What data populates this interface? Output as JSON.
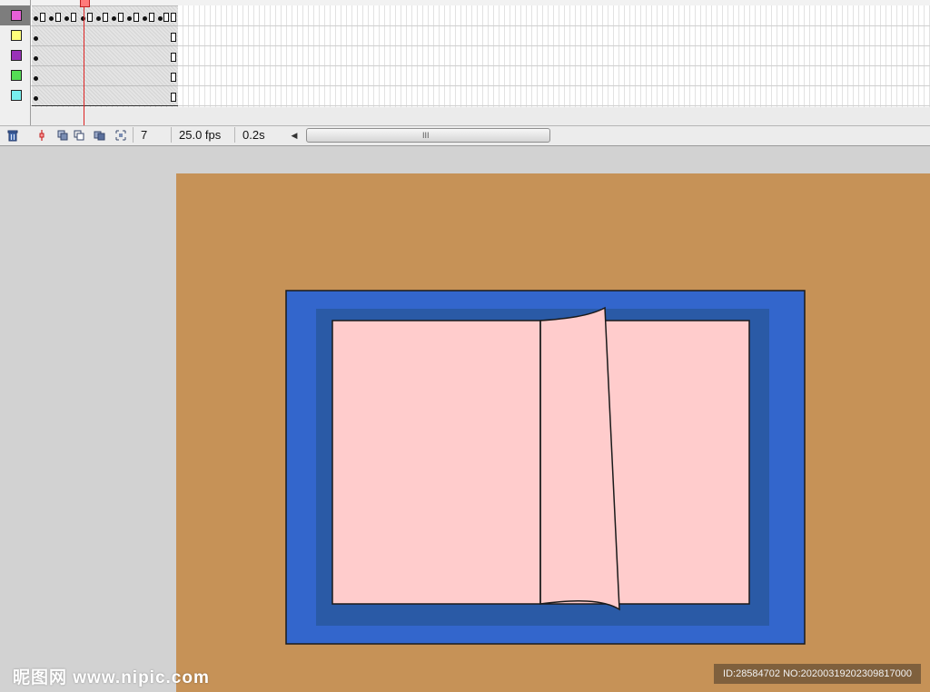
{
  "timeline": {
    "layers": [
      {
        "color": "#e65fd8",
        "selected": true
      },
      {
        "color": "#ffff7a",
        "selected": false
      },
      {
        "color": "#9932b8",
        "selected": false
      },
      {
        "color": "#55dd55",
        "selected": false
      },
      {
        "color": "#77eeee",
        "selected": false
      }
    ],
    "current_frame": "7",
    "frame_rate": "25.0 fps",
    "elapsed_time": "0.2s",
    "scroll_grip": "III",
    "scroll_left_arrow": "◀",
    "icons": {
      "delete": "trash-icon",
      "center_frame": "center-frame-icon",
      "onion_skin": "onion-skin-icon",
      "onion_outlines": "onion-skin-outlines-icon",
      "edit_multiple": "edit-multiple-frames-icon",
      "onion_markers": "onion-markers-icon"
    }
  },
  "stage": {
    "background": "#c69257",
    "frame_outer": "#3366cc",
    "frame_inner": "#2a5aa6",
    "page_color": "#ffcccc"
  },
  "watermark": {
    "logo": "昵图网 www.nipic.com",
    "id_text": "ID:28584702 NO:20200319202309817000"
  }
}
